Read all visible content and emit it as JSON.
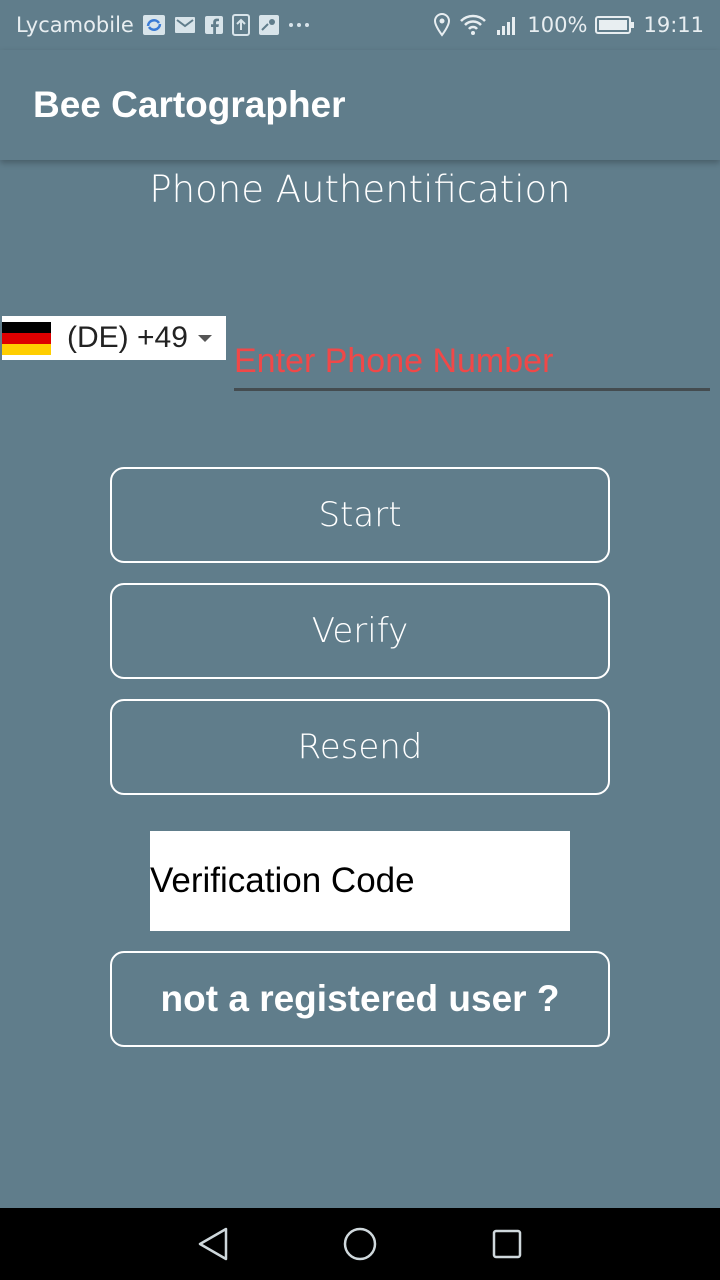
{
  "status_bar": {
    "carrier": "Lycamobile",
    "battery": "100%",
    "time": "19:11",
    "icons": [
      "sync-icon",
      "gmail-icon",
      "facebook-icon",
      "upload-icon",
      "maps-icon",
      "more-icon",
      "location-icon",
      "wifi-icon",
      "signal-icon",
      "battery-icon"
    ]
  },
  "app_bar": {
    "title": "Bee Cartographer"
  },
  "page": {
    "heading": "Phone Authentification"
  },
  "country_picker": {
    "label": "(DE) +49",
    "flag_colors": [
      "#000000",
      "#dd0000",
      "#ffce00"
    ]
  },
  "phone_input": {
    "placeholder": "Enter Phone Number",
    "value": ""
  },
  "buttons": {
    "start": "Start",
    "verify": "Verify",
    "resend": "Resend",
    "register": "not a registered user ?"
  },
  "code_input": {
    "placeholder": "Verification Code",
    "value": ""
  },
  "nav_bar": {
    "icons": [
      "back-icon",
      "home-icon",
      "recents-icon"
    ]
  },
  "colors": {
    "background": "#607d8b",
    "hint": "#f04848",
    "underline": "#444c50"
  }
}
